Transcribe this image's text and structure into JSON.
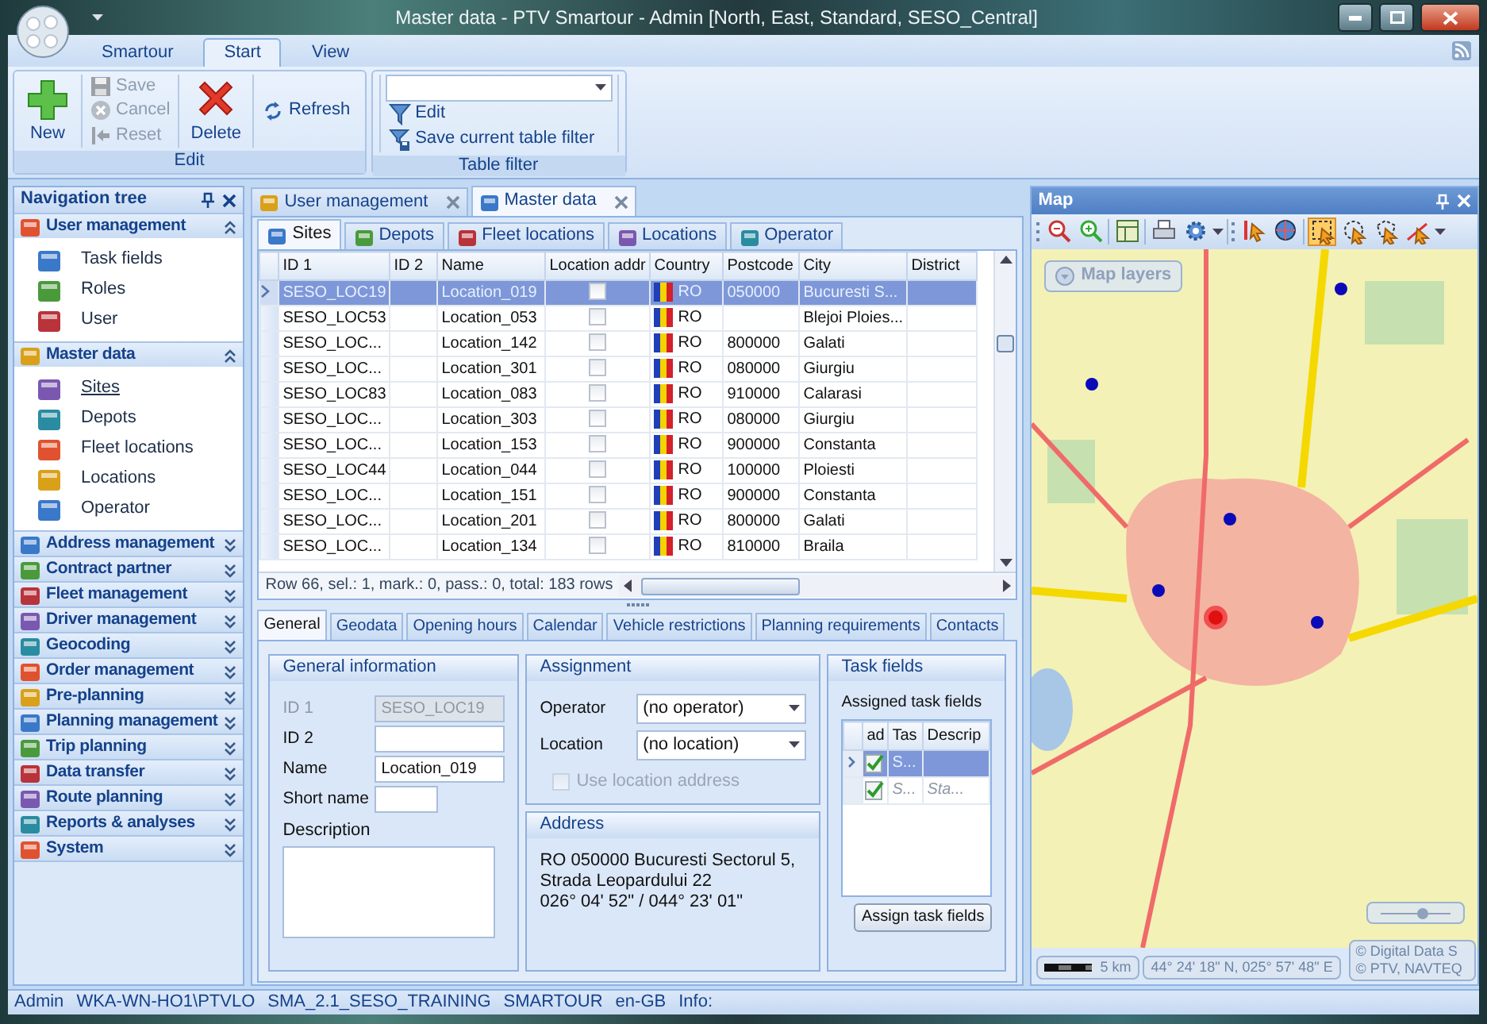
{
  "window": {
    "title": "Master data - PTV Smartour - Admin [North, East, Standard, SESO_Central]"
  },
  "ribbon": {
    "tabs": [
      {
        "label": "Smartour",
        "selected": false
      },
      {
        "label": "Start",
        "selected": true
      },
      {
        "label": "View",
        "selected": false
      }
    ],
    "groups": [
      {
        "label": "Edit",
        "buttons": [
          {
            "kind": "large",
            "label": "New",
            "disabled": false
          },
          {
            "kind": "small",
            "label": "Save",
            "disabled": true
          },
          {
            "kind": "small",
            "label": "Cancel",
            "disabled": true
          },
          {
            "kind": "small",
            "label": "Reset",
            "disabled": true
          },
          {
            "kind": "large",
            "label": "Delete",
            "disabled": false
          },
          {
            "kind": "small",
            "label": "Refresh",
            "disabled": false
          }
        ]
      },
      {
        "label": "Table filter",
        "buttons": [
          {
            "kind": "combo",
            "disabled": false
          },
          {
            "kind": "small",
            "label": "Edit",
            "disabled": false
          },
          {
            "kind": "small",
            "label": "Save current table filter",
            "disabled": false
          }
        ]
      }
    ]
  },
  "navigation": {
    "title": "Navigation tree",
    "sections": [
      {
        "label": "User management",
        "expanded": true,
        "items": [
          {
            "label": "Task fields",
            "selected": false
          },
          {
            "label": "Roles",
            "selected": false
          },
          {
            "label": "User",
            "selected": false
          }
        ]
      },
      {
        "label": "Master data",
        "expanded": true,
        "items": [
          {
            "label": "Sites",
            "selected": true
          },
          {
            "label": "Depots",
            "selected": false
          },
          {
            "label": "Fleet locations",
            "selected": false
          },
          {
            "label": "Locations",
            "selected": false
          },
          {
            "label": "Operator",
            "selected": false
          }
        ]
      },
      {
        "label": "Address management",
        "expanded": false
      },
      {
        "label": "Contract partner",
        "expanded": false
      },
      {
        "label": "Fleet management",
        "expanded": false
      },
      {
        "label": "Driver management",
        "expanded": false
      },
      {
        "label": "Geocoding",
        "expanded": false
      },
      {
        "label": "Order management",
        "expanded": false
      },
      {
        "label": "Pre-planning",
        "expanded": false
      },
      {
        "label": "Planning management",
        "expanded": false
      },
      {
        "label": "Trip planning",
        "expanded": false
      },
      {
        "label": "Data transfer",
        "expanded": false
      },
      {
        "label": "Route planning",
        "expanded": false
      },
      {
        "label": "Reports & analyses",
        "expanded": false
      },
      {
        "label": "System",
        "expanded": false
      }
    ]
  },
  "document_tabs": [
    {
      "label": "User management",
      "selected": false
    },
    {
      "label": "Master data",
      "selected": true
    }
  ],
  "sub_tabs": [
    {
      "label": "Sites",
      "selected": true
    },
    {
      "label": "Depots",
      "selected": false
    },
    {
      "label": "Fleet locations",
      "selected": false
    },
    {
      "label": "Locations",
      "selected": false
    },
    {
      "label": "Operator",
      "selected": false
    }
  ],
  "table": {
    "columns": [
      "ID 1",
      "ID 2",
      "Name",
      "Location addr",
      "Country",
      "Postcode",
      "City",
      "District"
    ],
    "rows": [
      {
        "selected": true,
        "id_1": "SESO_LOC19",
        "name": "Location_019",
        "location_addr": false,
        "country": "RO",
        "postcode": "050000",
        "city": "Bucuresti S..."
      },
      {
        "selected": false,
        "id_1": "SESO_LOC53",
        "name": "Location_053",
        "location_addr": false,
        "country": "RO",
        "city": "Blejoi Ploies..."
      },
      {
        "selected": false,
        "id_1": "SESO_LOC...",
        "name": "Location_142",
        "location_addr": false,
        "country": "RO",
        "postcode": "800000",
        "city": "Galati"
      },
      {
        "selected": false,
        "id_1": "SESO_LOC...",
        "name": "Location_301",
        "location_addr": false,
        "country": "RO",
        "postcode": "080000",
        "city": "Giurgiu"
      },
      {
        "selected": false,
        "id_1": "SESO_LOC83",
        "name": "Location_083",
        "location_addr": false,
        "country": "RO",
        "postcode": "910000",
        "city": "Calarasi"
      },
      {
        "selected": false,
        "id_1": "SESO_LOC...",
        "name": "Location_303",
        "location_addr": false,
        "country": "RO",
        "postcode": "080000",
        "city": "Giurgiu"
      },
      {
        "selected": false,
        "id_1": "SESO_LOC...",
        "name": "Location_153",
        "location_addr": false,
        "country": "RO",
        "postcode": "900000",
        "city": "Constanta"
      },
      {
        "selected": false,
        "id_1": "SESO_LOC44",
        "name": "Location_044",
        "location_addr": false,
        "country": "RO",
        "postcode": "100000",
        "city": "Ploiesti"
      },
      {
        "selected": false,
        "id_1": "SESO_LOC...",
        "name": "Location_151",
        "location_addr": false,
        "country": "RO",
        "postcode": "900000",
        "city": "Constanta"
      },
      {
        "selected": false,
        "id_1": "SESO_LOC...",
        "name": "Location_201",
        "location_addr": false,
        "country": "RO",
        "postcode": "800000",
        "city": "Galati"
      },
      {
        "selected": false,
        "id_1": "SESO_LOC...",
        "name": "Location_134",
        "location_addr": false,
        "country": "RO",
        "postcode": "810000",
        "city": "Braila"
      }
    ],
    "status": "Row 66, sel.: 1, mark.: 0, pass.: 0, total: 183 rows"
  },
  "detail_tabs": [
    {
      "label": "General",
      "selected": true
    },
    {
      "label": "Geodata",
      "selected": false
    },
    {
      "label": "Opening hours",
      "selected": false
    },
    {
      "label": "Calendar",
      "selected": false
    },
    {
      "label": "Vehicle restrictions",
      "selected": false
    },
    {
      "label": "Planning requirements",
      "selected": false
    },
    {
      "label": "Contacts",
      "selected": false
    }
  ],
  "general_information": {
    "title": "General information",
    "fields": [
      {
        "label": "ID 1",
        "value": "SESO_LOC19",
        "disabled": true
      },
      {
        "label": "ID 2",
        "disabled": false
      },
      {
        "label": "Name",
        "value": "Location_019",
        "disabled": false
      },
      {
        "label": "Short name",
        "disabled": false
      }
    ],
    "description_label": "Description"
  },
  "assignment": {
    "title": "Assignment",
    "fields": [
      {
        "label": "Operator",
        "value": "(no operator)"
      },
      {
        "label": "Location",
        "value": "(no location)"
      }
    ],
    "checkbox": {
      "label": "Use location address",
      "checked": false,
      "disabled": true
    }
  },
  "address": {
    "title": "Address",
    "text": "RO 050000 Bucuresti Sectorul 5, Strada Leopardului 22",
    "coordinates": "026° 04' 52\" / 044° 23' 01\""
  },
  "task_fields": {
    "title": "Task fields",
    "label": "Assigned task fields",
    "columns": [
      "ad",
      "Tas",
      "Descrip"
    ],
    "rows": [
      {
        "selected": true,
        "checked": true,
        "disabled": false,
        "task": "S..."
      },
      {
        "selected": false,
        "checked": true,
        "disabled": true,
        "task": "S...",
        "description": "Sta..."
      }
    ],
    "button": "Assign task fields"
  },
  "map": {
    "title": "Map",
    "tools": [
      {
        "selected": false
      },
      {
        "selected": false
      },
      {
        "selected": false
      },
      {
        "selected": false
      },
      {
        "selected": false
      },
      {
        "selected": false
      },
      {
        "selected": false
      },
      {
        "selected": true
      },
      {
        "selected": false
      },
      {
        "selected": false
      },
      {
        "selected": false
      }
    ],
    "layers_button": "Map layers",
    "zoom_slider": {
      "level": 0.55
    },
    "scale": "5 km",
    "coordinates": "44° 24' 18\" N, 025° 57' 48\" E",
    "copyright": [
      "© Digital Data S",
      "© PTV, NAVTEQ"
    ]
  },
  "status_bar": [
    "Admin",
    "WKA-WN-HO1\\PTVLO",
    "SMA_2.1_SESO_TRAINING",
    "SMARTOUR",
    "en-GB",
    "Info:"
  ]
}
